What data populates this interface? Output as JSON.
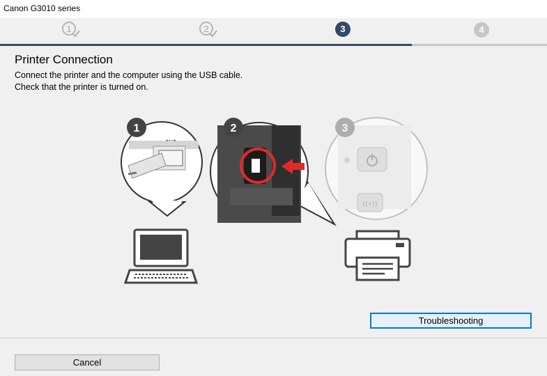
{
  "window": {
    "title": "Canon G3010 series"
  },
  "steps": [
    {
      "number": "1",
      "state": "done"
    },
    {
      "number": "2",
      "state": "done"
    },
    {
      "number": "3",
      "state": "current"
    },
    {
      "number": "4",
      "state": "pending"
    }
  ],
  "colors": {
    "current_step": "#334a66",
    "done_bar": "#334a66",
    "pending": "#c6c6c6",
    "accent": "#0078d7",
    "arrow": "#e02a2a"
  },
  "main": {
    "title": "Printer Connection",
    "instructions": [
      "Connect the printer and the computer using the USB cable.",
      "Check that the printer is turned on."
    ]
  },
  "illustration": {
    "callouts": [
      "1",
      "2",
      "3"
    ],
    "icons": [
      "usb-plug-icon",
      "usb-port-icon",
      "power-button-icon",
      "wireless-button-icon",
      "laptop-icon",
      "printer-icon"
    ]
  },
  "buttons": {
    "troubleshooting": "Troubleshooting",
    "cancel": "Cancel"
  }
}
